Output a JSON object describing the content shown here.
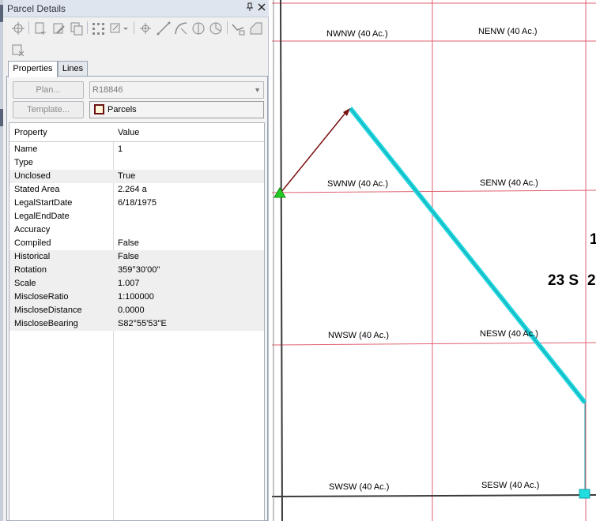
{
  "panel": {
    "title": "Parcel Details",
    "pin_icon": "pin-icon",
    "close_icon": "close-icon"
  },
  "tabs": [
    {
      "label": "Properties",
      "active": true
    },
    {
      "label": "Lines",
      "active": false
    }
  ],
  "form": {
    "plan_button": "Plan...",
    "plan_value": "R18846",
    "template_button": "Template...",
    "layer_name": "Parcels"
  },
  "grid": {
    "header_property": "Property",
    "header_value": "Value",
    "rows": [
      {
        "property": "Name",
        "value": "1"
      },
      {
        "property": "Type",
        "value": ""
      },
      {
        "property": "Unclosed",
        "value": "True"
      },
      {
        "property": "Stated Area",
        "value": "2.264 a"
      },
      {
        "property": "LegalStartDate",
        "value": "6/18/1975"
      },
      {
        "property": "LegalEndDate",
        "value": ""
      },
      {
        "property": "Accuracy",
        "value": ""
      },
      {
        "property": "Compiled",
        "value": "False"
      },
      {
        "property": "Historical",
        "value": "False"
      },
      {
        "property": "Rotation",
        "value": "359°30'00\""
      },
      {
        "property": "Scale",
        "value": "1.007"
      },
      {
        "property": "MiscloseRatio",
        "value": "1:100000"
      },
      {
        "property": "MiscloseDistance",
        "value": "0.0000"
      },
      {
        "property": "MiscloseBearing",
        "value": "S82°55'53\"E"
      }
    ]
  },
  "map": {
    "labels": {
      "nwnw": "NWNW (40 Ac.)",
      "nenw": "NENW (40 Ac.)",
      "swnw": "SWNW (40 Ac.)",
      "senw": "SENW (40 Ac.)",
      "nwsw": "NWSW (40 Ac.)",
      "nesw": "NESW (40 Ac.)",
      "swsw": "SWSW (40 Ac.)",
      "sesw": "SESW (40 Ac.)",
      "township": "23 S",
      "range_partial": "2",
      "section_partial": "1"
    },
    "colors": {
      "grid_line": "#e06070",
      "section_line": "#3a3a3a",
      "parcel_line": "#21d6e0",
      "arrow": "#7a1010",
      "start_point": "#22cc22",
      "end_point": "#22dde0"
    }
  },
  "toolbar": {
    "icons": [
      "select-point-icon",
      "new-parcel-icon",
      "edit-parcel-icon",
      "copy-parcel-icon",
      "grid-icon",
      "construction-dropdown-icon",
      "point-icon",
      "line-icon",
      "curve-icon",
      "circle-icon",
      "closure-icon",
      "traverse-icon",
      "area-icon",
      "clear-icon"
    ]
  }
}
